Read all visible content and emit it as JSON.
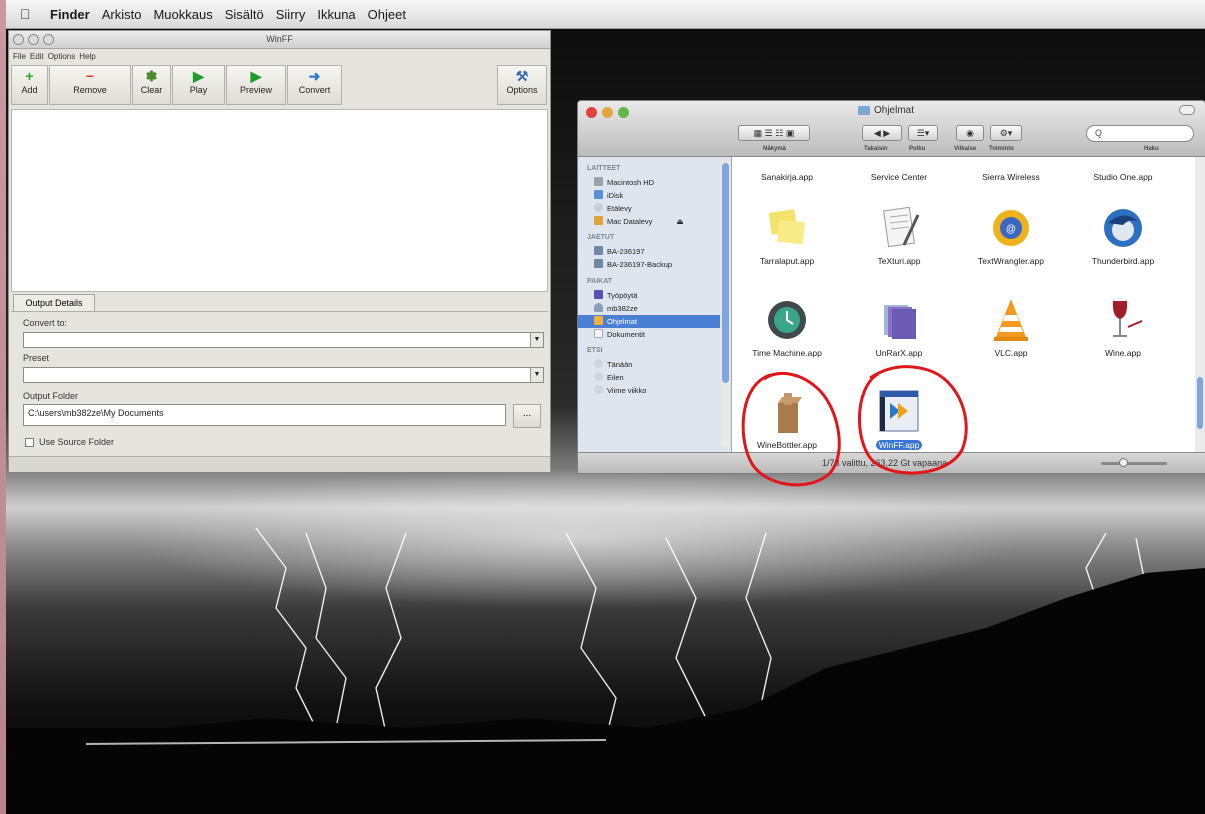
{
  "menubar": {
    "app": "Finder",
    "items": [
      "Arkisto",
      "Muokkaus",
      "Sisältö",
      "Siirry",
      "Ikkuna",
      "Ohjeet"
    ]
  },
  "winff": {
    "title": "WinFF",
    "menus": [
      "File",
      "Edit",
      "Options",
      "Help"
    ],
    "toolbar": [
      {
        "label": "Add",
        "icon": "plus-icon",
        "color": "#2aa52a"
      },
      {
        "label": "Remove",
        "icon": "minus-icon",
        "color": "#d63b24"
      },
      {
        "label": "Clear",
        "icon": "broom-icon",
        "color": "#4a8a2f"
      },
      {
        "label": "Play",
        "icon": "play-icon",
        "color": "#1e9b2a"
      },
      {
        "label": "Preview",
        "icon": "preview-icon",
        "color": "#1e9b2a"
      },
      {
        "label": "Convert",
        "icon": "convert-icon",
        "color": "#2b78c5"
      },
      {
        "label": "Options",
        "icon": "tools-icon",
        "color": "#3b6ab0"
      }
    ],
    "tab": "Output Details",
    "convert_to_label": "Convert to:",
    "preset_label": "Preset",
    "output_folder_label": "Output Folder",
    "output_folder_value": "C:\\users\\mb382ze\\My Documents",
    "browse_label": "...",
    "use_source_label": "Use Source Folder"
  },
  "finder": {
    "title": "Ohjelmat",
    "toolbar_labels": [
      "Näkymä",
      "Takaisin",
      "Polku",
      "Vilkaise",
      "Toiminto",
      "Haku"
    ],
    "search_placeholder": "Q",
    "sidebar": {
      "sections": [
        {
          "header": "LAITTEET",
          "items": [
            "Macintosh HD",
            "iDisk",
            "Etälevy",
            "Mac Datalevy"
          ]
        },
        {
          "header": "JAETUT",
          "items": [
            "BA-236197",
            "BA-236197-Backup"
          ]
        },
        {
          "header": "PAIKAT",
          "items": [
            "Työpöytä",
            "mb382ze",
            "Ohjelmat",
            "Dokumentit"
          ]
        },
        {
          "header": "ETSI",
          "items": [
            "Tänään",
            "Eilen",
            "Viime viikko"
          ]
        }
      ],
      "selected": "Ohjelmat"
    },
    "apps_top_row": [
      "Sanakirja.app",
      "Service Center",
      "Sierra Wireless",
      "Studio One.app"
    ],
    "apps": [
      {
        "name": "Tarralaput.app",
        "icon": "sticky-notes-icon"
      },
      {
        "name": "TeXturi.app",
        "icon": "text-editor-icon"
      },
      {
        "name": "TextWrangler.app",
        "icon": "textwrangler-icon"
      },
      {
        "name": "Thunderbird.app",
        "icon": "thunderbird-icon"
      },
      {
        "name": "Time Machine.app",
        "icon": "time-machine-icon"
      },
      {
        "name": "UnRarX.app",
        "icon": "unrarx-icon"
      },
      {
        "name": "VLC.app",
        "icon": "vlc-cone-icon"
      },
      {
        "name": "Wine.app",
        "icon": "wine-glass-icon"
      },
      {
        "name": "WineBottler.app",
        "icon": "winebottler-icon"
      },
      {
        "name": "WinFF.app",
        "icon": "winff-icon"
      }
    ],
    "selected_app": "WinFF.app",
    "status": "1/73 valittu, 263,22 Gt vapaana"
  },
  "colors": {
    "selection": "#3875d7",
    "annotation_red": "#e0161b",
    "close": "#e0443e",
    "minimize": "#e1a73c",
    "zoom": "#62b84a"
  }
}
